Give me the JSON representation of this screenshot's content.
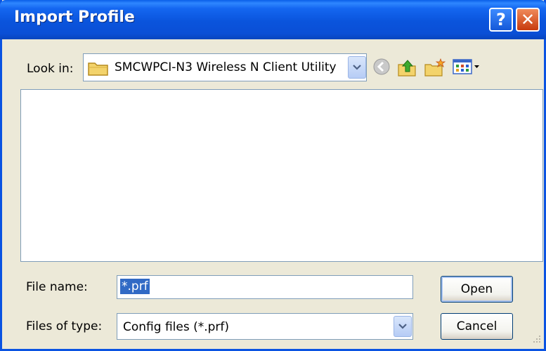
{
  "window": {
    "title": "Import Profile",
    "help_glyph": "?",
    "close_glyph": "✕"
  },
  "look_in": {
    "label": "Look in:",
    "value": "SMCWPCI-N3 Wireless N Client Utility",
    "icon": "folder-icon"
  },
  "toolbar": {
    "icons": [
      "back-icon",
      "up-folder-icon",
      "new-folder-icon",
      "view-menu-icon"
    ]
  },
  "file_list": {
    "items": []
  },
  "file_name": {
    "label": "File name:",
    "value": "*.prf"
  },
  "file_type": {
    "label": "Files of type:",
    "value": "Config files (*.prf)"
  },
  "buttons": {
    "open_label": "Open",
    "cancel_label": "Cancel"
  },
  "colors": {
    "title_bar": "#0A54DC",
    "dialog_bg": "#ECE9D8",
    "selection": "#316AC5",
    "close_button": "#C73A0E"
  }
}
